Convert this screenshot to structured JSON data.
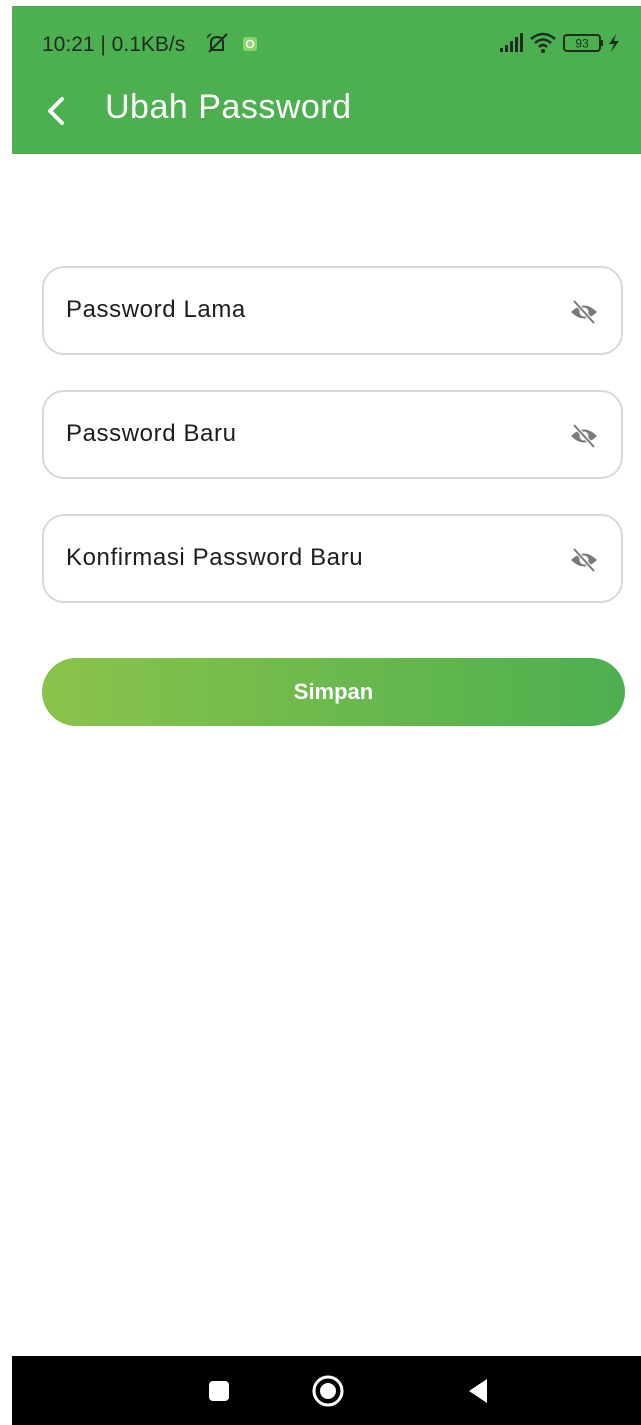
{
  "status_bar": {
    "time_and_speed": "10:21 | 0.1KB/s",
    "icons": [
      "muted-notification-icon",
      "app-notification-icon",
      "signal-icon",
      "wifi-icon",
      "battery-icon",
      "charging-icon"
    ],
    "battery_level": "93"
  },
  "toolbar": {
    "back_icon": "chevron-left-icon",
    "title": "Ubah Password"
  },
  "form": {
    "old_password_label": "Password Lama",
    "new_password_label": "Password Baru",
    "confirm_password_label": "Konfirmasi Password Baru",
    "visibility_icon": "eye-off-icon",
    "save_label": "Simpan"
  },
  "nav_bar": {
    "icons": [
      "recents-square-icon",
      "home-circle-icon",
      "back-triangle-icon"
    ]
  },
  "colors": {
    "header": "#4caf50",
    "button_gradient_start": "#8bc34a",
    "button_gradient_end": "#4caf50",
    "field_border": "#d8d8d8",
    "nav_background": "#000000"
  }
}
